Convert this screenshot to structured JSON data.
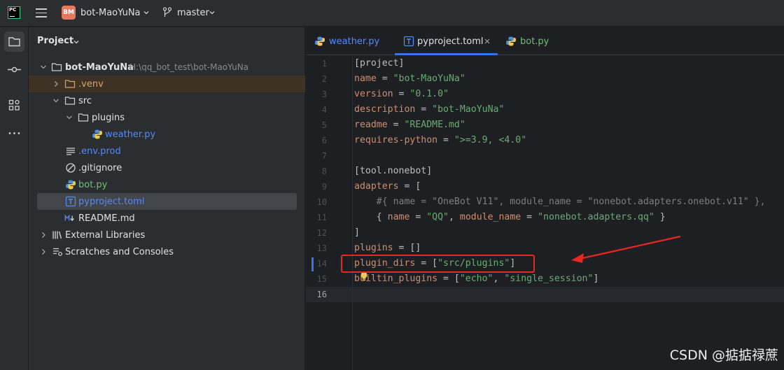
{
  "titlebar": {
    "project_badge": "BM",
    "project_name": "bot-MaoYuNa",
    "branch": "master"
  },
  "project_panel": {
    "title": "Project",
    "tree": [
      {
        "label": "bot-MaoYuNa",
        "path": "H:\\qq_bot_test\\bot-MaoYuNa",
        "kind": "root-folder"
      },
      {
        "label": ".venv",
        "kind": "excluded-folder"
      },
      {
        "label": "src",
        "kind": "folder"
      },
      {
        "label": "plugins",
        "kind": "folder"
      },
      {
        "label": "weather.py",
        "kind": "python-file"
      },
      {
        "label": ".env.prod",
        "kind": "text-file"
      },
      {
        "label": ".gitignore",
        "kind": "ignore-file"
      },
      {
        "label": "bot.py",
        "kind": "python-file"
      },
      {
        "label": "pyproject.toml",
        "kind": "toml-file"
      },
      {
        "label": "README.md",
        "kind": "markdown-file"
      },
      {
        "label": "External Libraries",
        "kind": "libraries"
      },
      {
        "label": "Scratches and Consoles",
        "kind": "scratches"
      }
    ]
  },
  "editor": {
    "tabs": [
      {
        "label": "weather.py",
        "active": false
      },
      {
        "label": "pyproject.toml",
        "active": true
      },
      {
        "label": "bot.py",
        "active": false
      }
    ],
    "line_numbers": [
      "1",
      "2",
      "3",
      "4",
      "5",
      "6",
      "7",
      "8",
      "9",
      "10",
      "11",
      "12",
      "13",
      "14",
      "15",
      "16"
    ],
    "current_line": "16",
    "code": [
      [
        {
          "t": "[project]",
          "c": "bracket"
        }
      ],
      [
        {
          "t": "name",
          "c": "key"
        },
        {
          "t": " = ",
          "c": "op"
        },
        {
          "t": "\"bot-MaoYuNa\"",
          "c": "str"
        }
      ],
      [
        {
          "t": "version",
          "c": "key"
        },
        {
          "t": " = ",
          "c": "op"
        },
        {
          "t": "\"0.1.0\"",
          "c": "str"
        }
      ],
      [
        {
          "t": "description",
          "c": "key"
        },
        {
          "t": " = ",
          "c": "op"
        },
        {
          "t": "\"bot-MaoYuNa\"",
          "c": "str"
        }
      ],
      [
        {
          "t": "readme",
          "c": "key"
        },
        {
          "t": " = ",
          "c": "op"
        },
        {
          "t": "\"README.md\"",
          "c": "str"
        }
      ],
      [
        {
          "t": "requires-python",
          "c": "key"
        },
        {
          "t": " = ",
          "c": "op"
        },
        {
          "t": "\">=3.9, <4.0\"",
          "c": "str"
        }
      ],
      [],
      [
        {
          "t": "[tool.nonebot]",
          "c": "bracket"
        }
      ],
      [
        {
          "t": "adapters",
          "c": "key"
        },
        {
          "t": " = [",
          "c": "op"
        }
      ],
      [
        {
          "t": "    #{ name = \"OneBot V11\", module_name = \"nonebot.adapters.onebot.v11\" },",
          "c": "comment"
        }
      ],
      [
        {
          "t": "    { ",
          "c": "op"
        },
        {
          "t": "name",
          "c": "key"
        },
        {
          "t": " = ",
          "c": "op"
        },
        {
          "t": "\"QQ\"",
          "c": "str"
        },
        {
          "t": ", ",
          "c": "op"
        },
        {
          "t": "module_name",
          "c": "key"
        },
        {
          "t": " = ",
          "c": "op"
        },
        {
          "t": "\"nonebot.adapters.qq\"",
          "c": "str"
        },
        {
          "t": " }",
          "c": "op"
        }
      ],
      [
        {
          "t": "]",
          "c": "op"
        }
      ],
      [
        {
          "t": "plugins",
          "c": "key"
        },
        {
          "t": " = []",
          "c": "op"
        }
      ],
      [
        {
          "t": "plugin_dirs",
          "c": "key"
        },
        {
          "t": " = [",
          "c": "op"
        },
        {
          "t": "\"src/plugins\"",
          "c": "str"
        },
        {
          "t": "]",
          "c": "op"
        }
      ],
      [
        {
          "t": "builtin_plugins",
          "c": "key"
        },
        {
          "t": " = [",
          "c": "op"
        },
        {
          "t": "\"echo\"",
          "c": "str"
        },
        {
          "t": ", ",
          "c": "op"
        },
        {
          "t": "\"single_session\"",
          "c": "str"
        },
        {
          "t": "]",
          "c": "op"
        }
      ],
      []
    ]
  },
  "watermark": "CSDN @掂掂禄蔗",
  "colors": {
    "accent": "#3574f0",
    "annotation": "#e8271e",
    "string": "#6aab73",
    "keyword": "#cf8e6d"
  }
}
